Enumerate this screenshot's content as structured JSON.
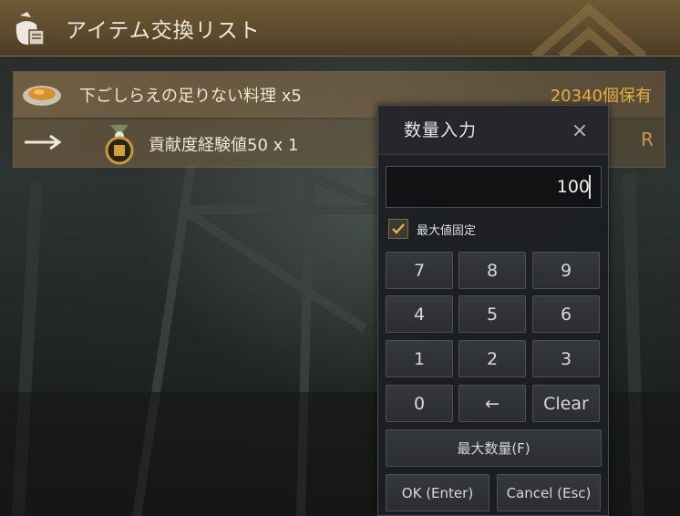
{
  "window": {
    "title": "アイテム交換リスト"
  },
  "exchange_list": {
    "required_item": {
      "name": "下ごしらえの足りない料理 x5",
      "stock": "20340個保有"
    },
    "reward_item": {
      "name": "貢献度経験値50 x 1",
      "rank": "R"
    }
  },
  "quantity_dialog": {
    "title": "数量入力",
    "close_symbol": "×",
    "input_value": "100",
    "checkbox": {
      "label": "最大値固定",
      "checked": true
    },
    "keys": {
      "k7": "7",
      "k8": "8",
      "k9": "9",
      "k4": "4",
      "k5": "5",
      "k6": "6",
      "k1": "1",
      "k2": "2",
      "k3": "3",
      "k0": "0",
      "backspace": "←",
      "clear": "Clear"
    },
    "max_button": "最大数量(F)",
    "ok_button": "OK (Enter)",
    "cancel_button": "Cancel (Esc)"
  },
  "colors": {
    "title_bar": "#5c4a2c",
    "stock_text": "#e8b23a",
    "rank_text": "#c79a4a",
    "dialog_bg": "#1c1e22"
  }
}
